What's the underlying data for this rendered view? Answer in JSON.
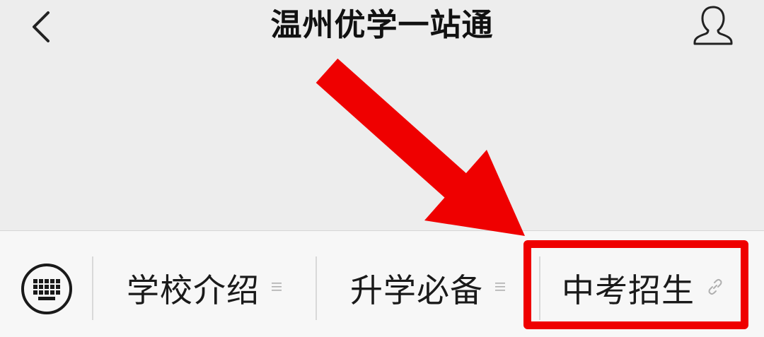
{
  "header": {
    "title": "温州优学一站通",
    "back_icon": "chevron-left-icon",
    "profile_icon": "user-icon"
  },
  "menu": {
    "keyboard_icon": "keyboard-icon",
    "items": [
      {
        "label": "学校介绍",
        "icon": "menu-lines-icon"
      },
      {
        "label": "升学必备",
        "icon": "menu-lines-icon"
      },
      {
        "label": "中考招生",
        "icon": "link-icon"
      }
    ]
  },
  "annotation": {
    "arrow_color": "#ef0000",
    "highlight_color": "#ef0000",
    "highlighted_item": "中考招生"
  }
}
